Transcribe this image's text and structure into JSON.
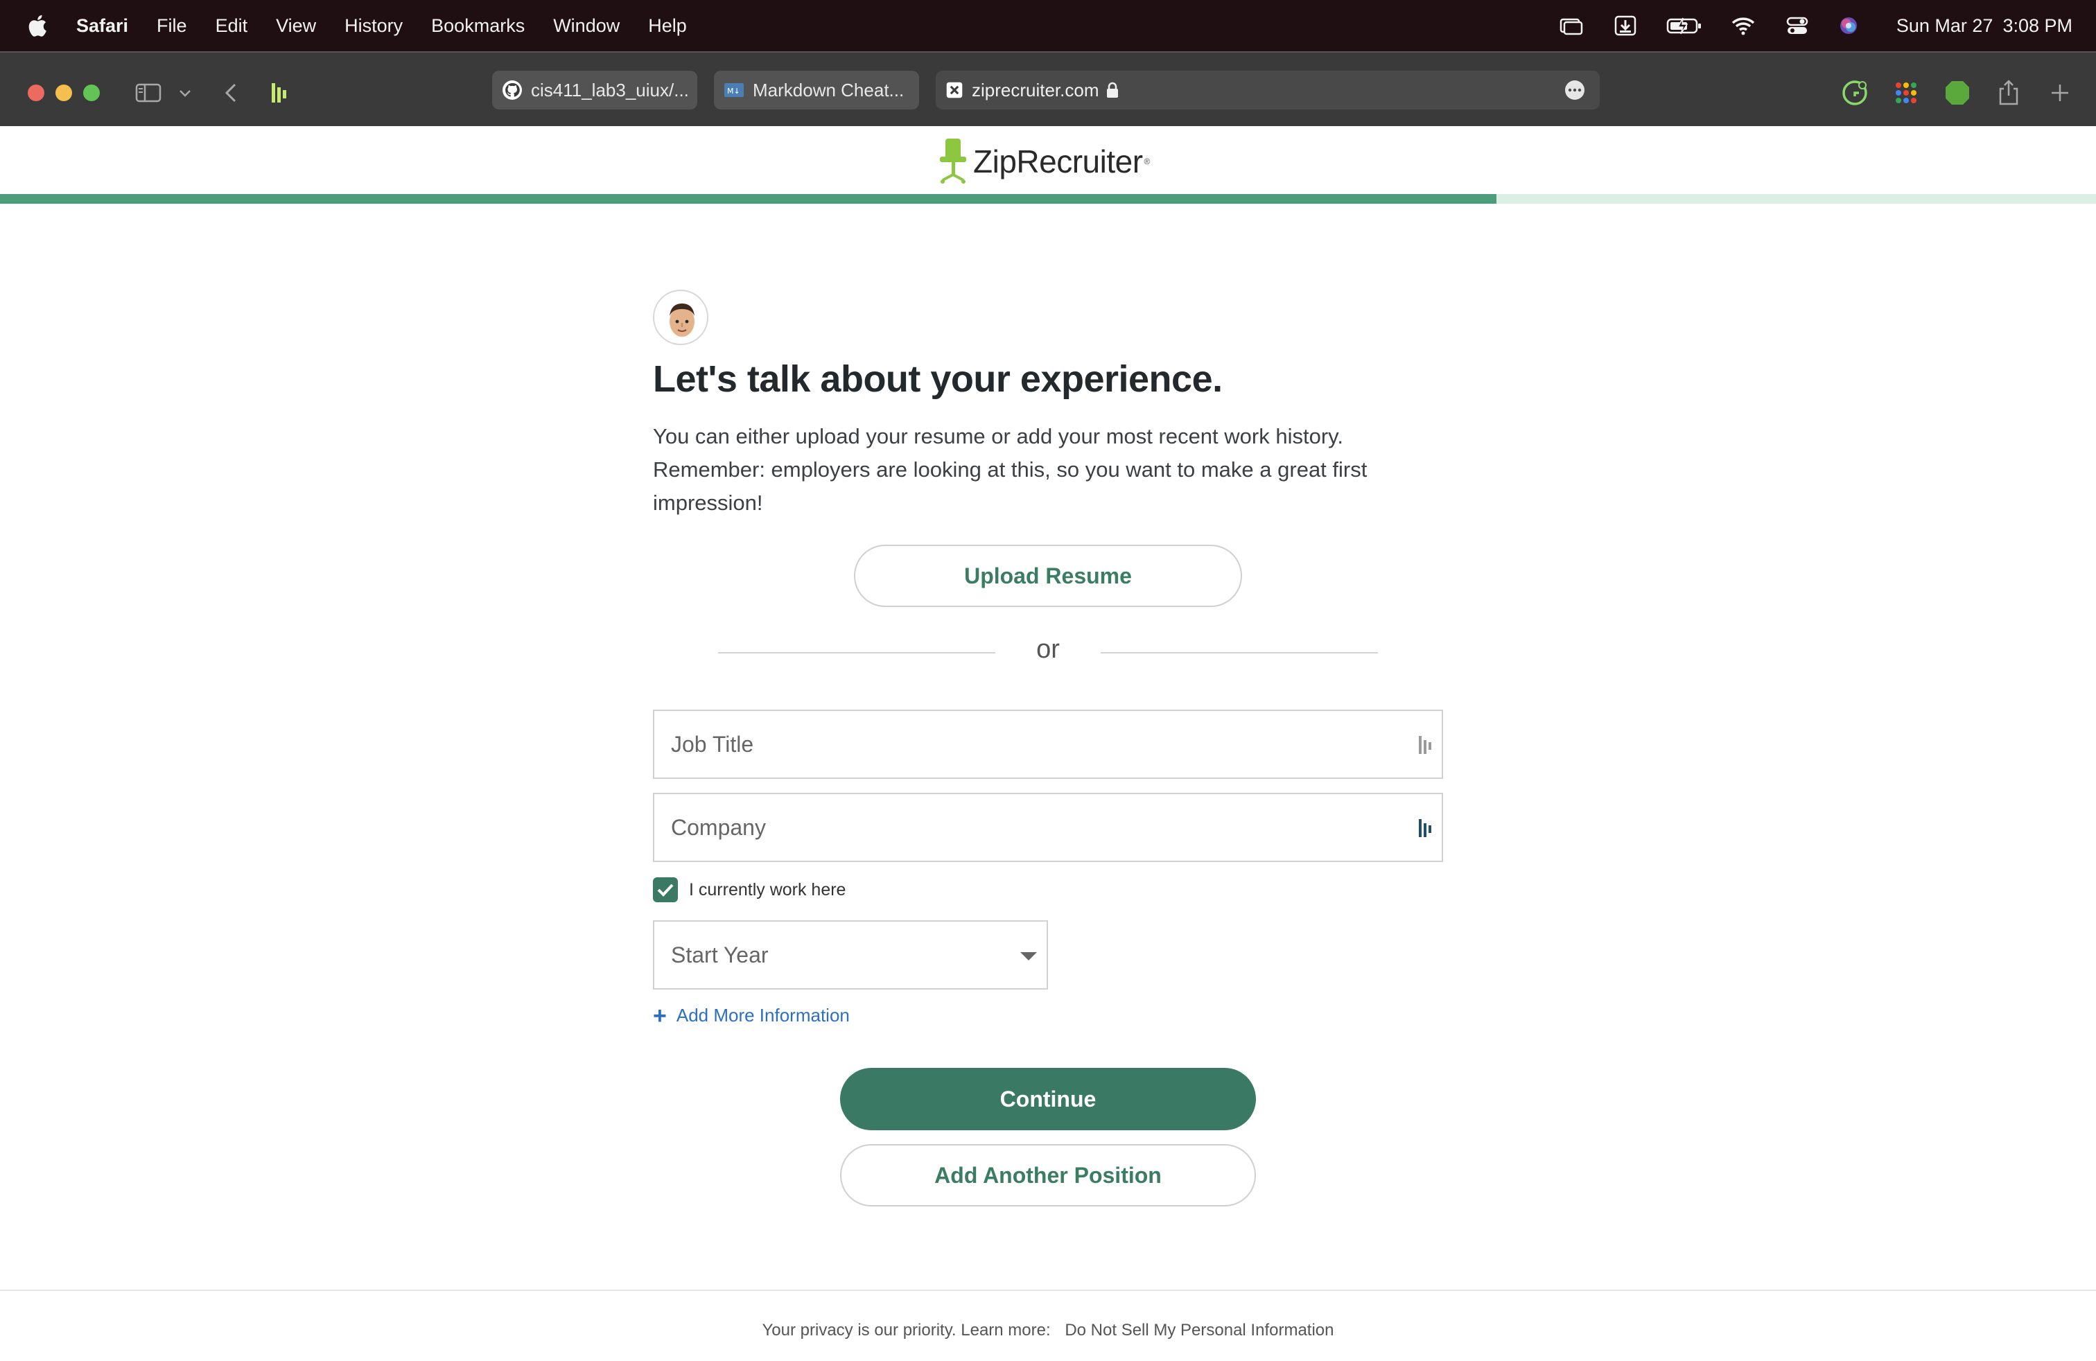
{
  "menubar": {
    "app": "Safari",
    "items": [
      "File",
      "Edit",
      "View",
      "History",
      "Bookmarks",
      "Window",
      "Help"
    ],
    "date": "Sun Mar 27",
    "time": "3:08 PM"
  },
  "browser": {
    "tabs": [
      {
        "label": "cis411_lab3_uiux/...",
        "icon": "github-icon"
      },
      {
        "label": "Markdown Cheat...",
        "icon": "markdown-icon"
      }
    ],
    "address": "ziprecruiter.com"
  },
  "page": {
    "logo_text": "ZipRecruiter",
    "progress_percent": 71.4,
    "headline": "Let's talk about your experience.",
    "subtext": "You can either upload your resume or add your most recent work history. Remember: employers are looking at this, so you want to make a great first impression!",
    "upload_button": "Upload Resume",
    "or_label": "or",
    "job_title_placeholder": "Job Title",
    "company_placeholder": "Company",
    "current_checkbox_label": "I currently work here",
    "current_checked": true,
    "start_year_placeholder": "Start Year",
    "add_more_label": "Add More Information",
    "continue_button": "Continue",
    "add_position_button": "Add Another Position"
  },
  "footer": {
    "privacy_text": "Your privacy is our priority. Learn more:",
    "privacy_link": "Do Not Sell My Personal Information"
  },
  "colors": {
    "brand_green": "#3a7a65",
    "progress_green": "#4b9d7b",
    "link_blue": "#2b6fc0"
  }
}
